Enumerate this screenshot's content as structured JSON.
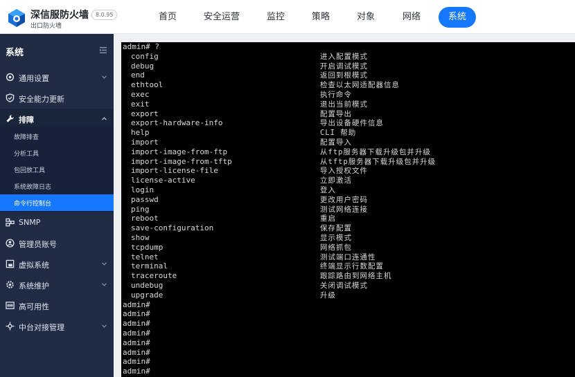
{
  "header": {
    "brand_title": "深信服防火墙",
    "brand_subtitle": "出口防火墙",
    "version": "8.0.95",
    "nav": [
      {
        "label": "首页",
        "active": false
      },
      {
        "label": "安全运营",
        "active": false
      },
      {
        "label": "监控",
        "active": false
      },
      {
        "label": "策略",
        "active": false
      },
      {
        "label": "对象",
        "active": false
      },
      {
        "label": "网络",
        "active": false
      },
      {
        "label": "系统",
        "active": true
      }
    ]
  },
  "sidebar": {
    "title": "系统",
    "items": [
      {
        "label": "通用设置",
        "icon": "gear-icon",
        "has_children": true
      },
      {
        "label": "安全能力更新",
        "icon": "shield-icon",
        "has_children": false
      },
      {
        "label": "排障",
        "icon": "wrench-icon",
        "has_children": true,
        "expanded": true
      },
      {
        "label": "SNMP",
        "icon": "network-icon",
        "has_children": false
      },
      {
        "label": "管理员账号",
        "icon": "user-icon",
        "has_children": false
      },
      {
        "label": "虚拟系统",
        "icon": "virtual-system-icon",
        "has_children": true
      },
      {
        "label": "系统维护",
        "icon": "maintenance-icon",
        "has_children": true
      },
      {
        "label": "高可用性",
        "icon": "high-availability-icon",
        "has_children": false
      },
      {
        "label": "中台对接管理",
        "icon": "hub-icon",
        "has_children": true
      }
    ],
    "troubleshoot_children": [
      {
        "label": "故障排查",
        "active": false
      },
      {
        "label": "分析工具",
        "active": false
      },
      {
        "label": "包回放工具",
        "active": false
      },
      {
        "label": "系统故障日志",
        "active": false
      },
      {
        "label": "命令行控制台",
        "active": true
      }
    ]
  },
  "terminal": {
    "prompt_line": "admin# ?",
    "commands": [
      {
        "cmd": "config",
        "desc": "进入配置模式"
      },
      {
        "cmd": "debug",
        "desc": "开启调试模式"
      },
      {
        "cmd": "end",
        "desc": "返回到根模式"
      },
      {
        "cmd": "ethtool",
        "desc": "检查以太网适配器信息"
      },
      {
        "cmd": "exec",
        "desc": "执行命令"
      },
      {
        "cmd": "exit",
        "desc": "退出当前模式"
      },
      {
        "cmd": "export",
        "desc": "配置导出"
      },
      {
        "cmd": "export-hardware-info",
        "desc": "导出设备硬件信息"
      },
      {
        "cmd": "help",
        "desc": "CLI 帮助"
      },
      {
        "cmd": "import",
        "desc": "配置导入"
      },
      {
        "cmd": "import-image-from-ftp",
        "desc": "从ftp服务器下载升级包并升级"
      },
      {
        "cmd": "import-image-from-tftp",
        "desc": "从tftp服务器下载升级包并升级"
      },
      {
        "cmd": "import-license-file",
        "desc": "导入授权文件"
      },
      {
        "cmd": "license-active",
        "desc": "立即激活"
      },
      {
        "cmd": "login",
        "desc": "登入"
      },
      {
        "cmd": "passwd",
        "desc": "更改用户密码"
      },
      {
        "cmd": "ping",
        "desc": "测试网络连接"
      },
      {
        "cmd": "reboot",
        "desc": "重启"
      },
      {
        "cmd": "save-configuration",
        "desc": "保存配置"
      },
      {
        "cmd": "show",
        "desc": "显示模式"
      },
      {
        "cmd": "tcpdump",
        "desc": "网络抓包"
      },
      {
        "cmd": "telnet",
        "desc": "测试端口连通性"
      },
      {
        "cmd": "terminal",
        "desc": "终端显示行数配置"
      },
      {
        "cmd": "traceroute",
        "desc": "跟踪路由到网络主机"
      },
      {
        "cmd": "undebug",
        "desc": "关闭调试模式"
      },
      {
        "cmd": "upgrade",
        "desc": "升级"
      }
    ],
    "trailing_prompts": [
      "admin#",
      "admin#",
      "admin#",
      "admin#",
      "admin#",
      "admin#",
      "admin#",
      "admin#"
    ]
  },
  "colors": {
    "accent": "#1677ff",
    "sidebar_bg": "#1f2c44",
    "terminal_bg": "#000000",
    "terminal_text": "#d8d8d8"
  }
}
